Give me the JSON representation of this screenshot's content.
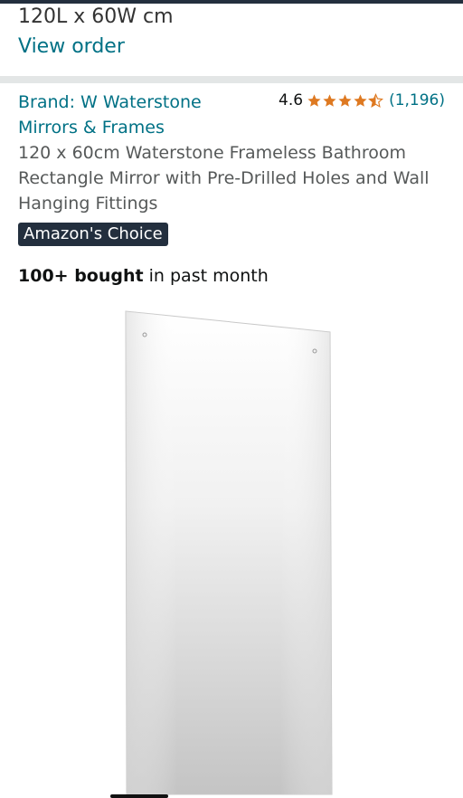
{
  "order": {
    "dimensions": "120L x 60W cm",
    "view_order_label": "View order"
  },
  "product": {
    "brand_line": "Brand: W Waterstone Mirrors & Frames",
    "rating_value": "4.6",
    "rating_count": "(1,196)",
    "star_rating": 4.6,
    "title": "120 x 60cm Waterstone Frameless Bathroom Rectangle Mirror with Pre-Drilled Holes and Wall Hanging Fittings",
    "badge": "Amazon's Choice",
    "bought_count": "100+ bought",
    "bought_suffix": " in past month"
  },
  "colors": {
    "link": "#007185",
    "star": "#DE7921",
    "badge_bg": "#232F3E"
  }
}
